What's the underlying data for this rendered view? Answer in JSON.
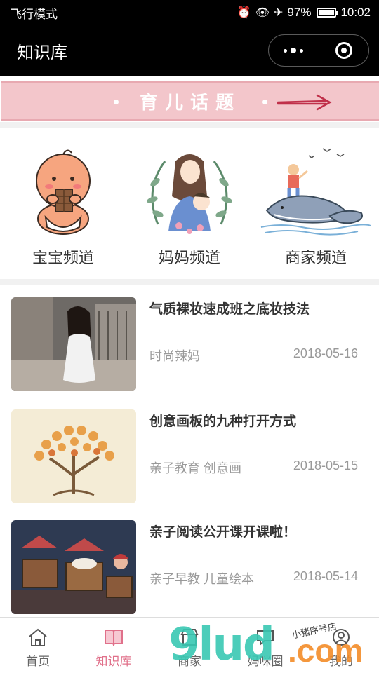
{
  "status_bar": {
    "left_text": "飞行模式",
    "icons": [
      "alarm-icon",
      "eye-icon",
      "airplane-icon"
    ],
    "battery_percent": "97%",
    "battery_level": 0.97,
    "time": "10:02"
  },
  "nav": {
    "title": "知识库",
    "menu_icon": "more-dots-icon",
    "close_icon": "target-close-icon"
  },
  "banner": {
    "title": "育儿话题",
    "accent_color": "#f3c6cb"
  },
  "channels": [
    {
      "label": "宝宝频道",
      "icon": "baby-icon"
    },
    {
      "label": "妈妈频道",
      "icon": "mother-icon"
    },
    {
      "label": "商家频道",
      "icon": "whale-boy-icon"
    }
  ],
  "articles": [
    {
      "title": "气质裸妆速成班之底妆技法",
      "tags": "时尚辣妈",
      "date": "2018-05-16"
    },
    {
      "title": "创意画板的九种打开方式",
      "tags": "亲子教育 创意画",
      "date": "2018-05-15"
    },
    {
      "title": "亲子阅读公开课开课啦！",
      "tags": "亲子早教 儿童绘本",
      "date": "2018-05-14"
    }
  ],
  "tabs": [
    {
      "label": "首页",
      "icon": "home-icon",
      "active": false
    },
    {
      "label": "知识库",
      "icon": "book-icon",
      "active": true
    },
    {
      "label": "商家",
      "icon": "shop-icon",
      "active": false
    },
    {
      "label": "妈咪圈",
      "icon": "chat-icon",
      "active": false
    },
    {
      "label": "我的",
      "icon": "user-icon",
      "active": false
    }
  ],
  "watermark": {
    "main": "9lud",
    "suffix": ".com",
    "handwriting": "小猪序号店"
  },
  "colors": {
    "active_tab": "#e0708a",
    "banner_border": "#e8a9b1"
  }
}
